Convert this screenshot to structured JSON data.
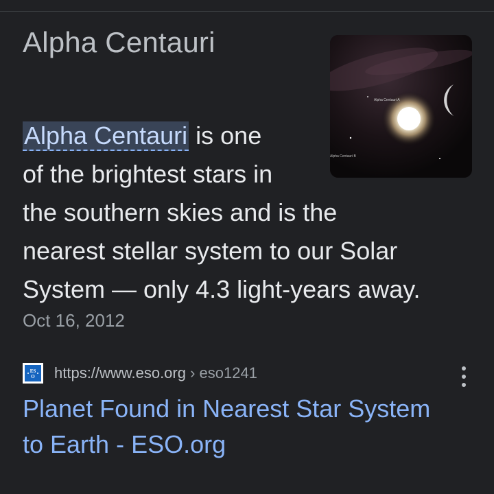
{
  "result": {
    "title": "Alpha Centauri",
    "snippet": {
      "highlight": "Alpha Centauri",
      "line1_rest": " is one",
      "line2": "of the brightest stars in",
      "line3": "the southern skies and is the",
      "line4": "nearest stellar system to our Solar",
      "line5": "System — only 4.3 light-years away."
    },
    "date": "Oct 16, 2012",
    "thumbnail": {
      "label_a": "Alpha Centauri B",
      "label_b": "Alpha Centauri A"
    },
    "source": {
      "favicon_icon": "eso-logo-icon",
      "url_domain": "https://www.eso.org",
      "url_path": " › eso1241"
    },
    "link": {
      "line1": "Planet Found in Nearest Star System",
      "line2": "to Earth - ESO.org"
    }
  },
  "colors": {
    "background": "#202124",
    "link": "#8ab4f8",
    "highlight_bg": "#394457",
    "text": "#e8eaed",
    "muted": "#9aa0a6"
  }
}
